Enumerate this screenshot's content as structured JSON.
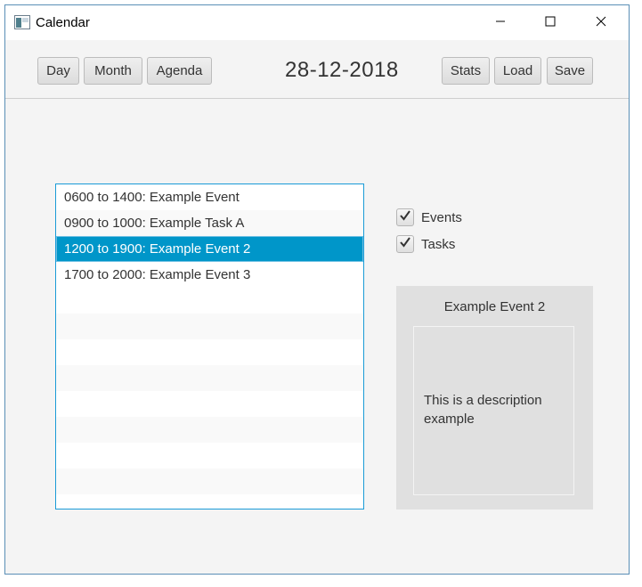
{
  "window": {
    "title": "Calendar"
  },
  "toolbar": {
    "day_label": "Day",
    "month_label": "Month",
    "agenda_label": "Agenda",
    "date": "28-12-2018",
    "stats_label": "Stats",
    "load_label": "Load",
    "save_label": "Save"
  },
  "events_list": {
    "items": [
      {
        "label": "0600 to 1400: Example Event"
      },
      {
        "label": "0900 to 1000: Example Task A"
      },
      {
        "label": "1200 to 1900: Example Event 2",
        "selected": true
      },
      {
        "label": "1700 to 2000: Example Event 3"
      },
      {
        "label": ""
      },
      {
        "label": ""
      },
      {
        "label": ""
      },
      {
        "label": ""
      },
      {
        "label": ""
      },
      {
        "label": ""
      },
      {
        "label": ""
      },
      {
        "label": ""
      }
    ]
  },
  "filters": {
    "events_label": "Events",
    "events_checked": true,
    "tasks_label": "Tasks",
    "tasks_checked": true
  },
  "detail": {
    "title": "Example Event 2",
    "description": "This is a description example"
  },
  "colors": {
    "selection": "#0096c9",
    "list_border": "#1a9bd7",
    "window_border": "#5a8fb6"
  },
  "icons": {
    "app": "calendar-app-icon",
    "minimize": "minimize-icon",
    "maximize": "maximize-icon",
    "close": "close-icon",
    "check": "checkmark-icon"
  }
}
